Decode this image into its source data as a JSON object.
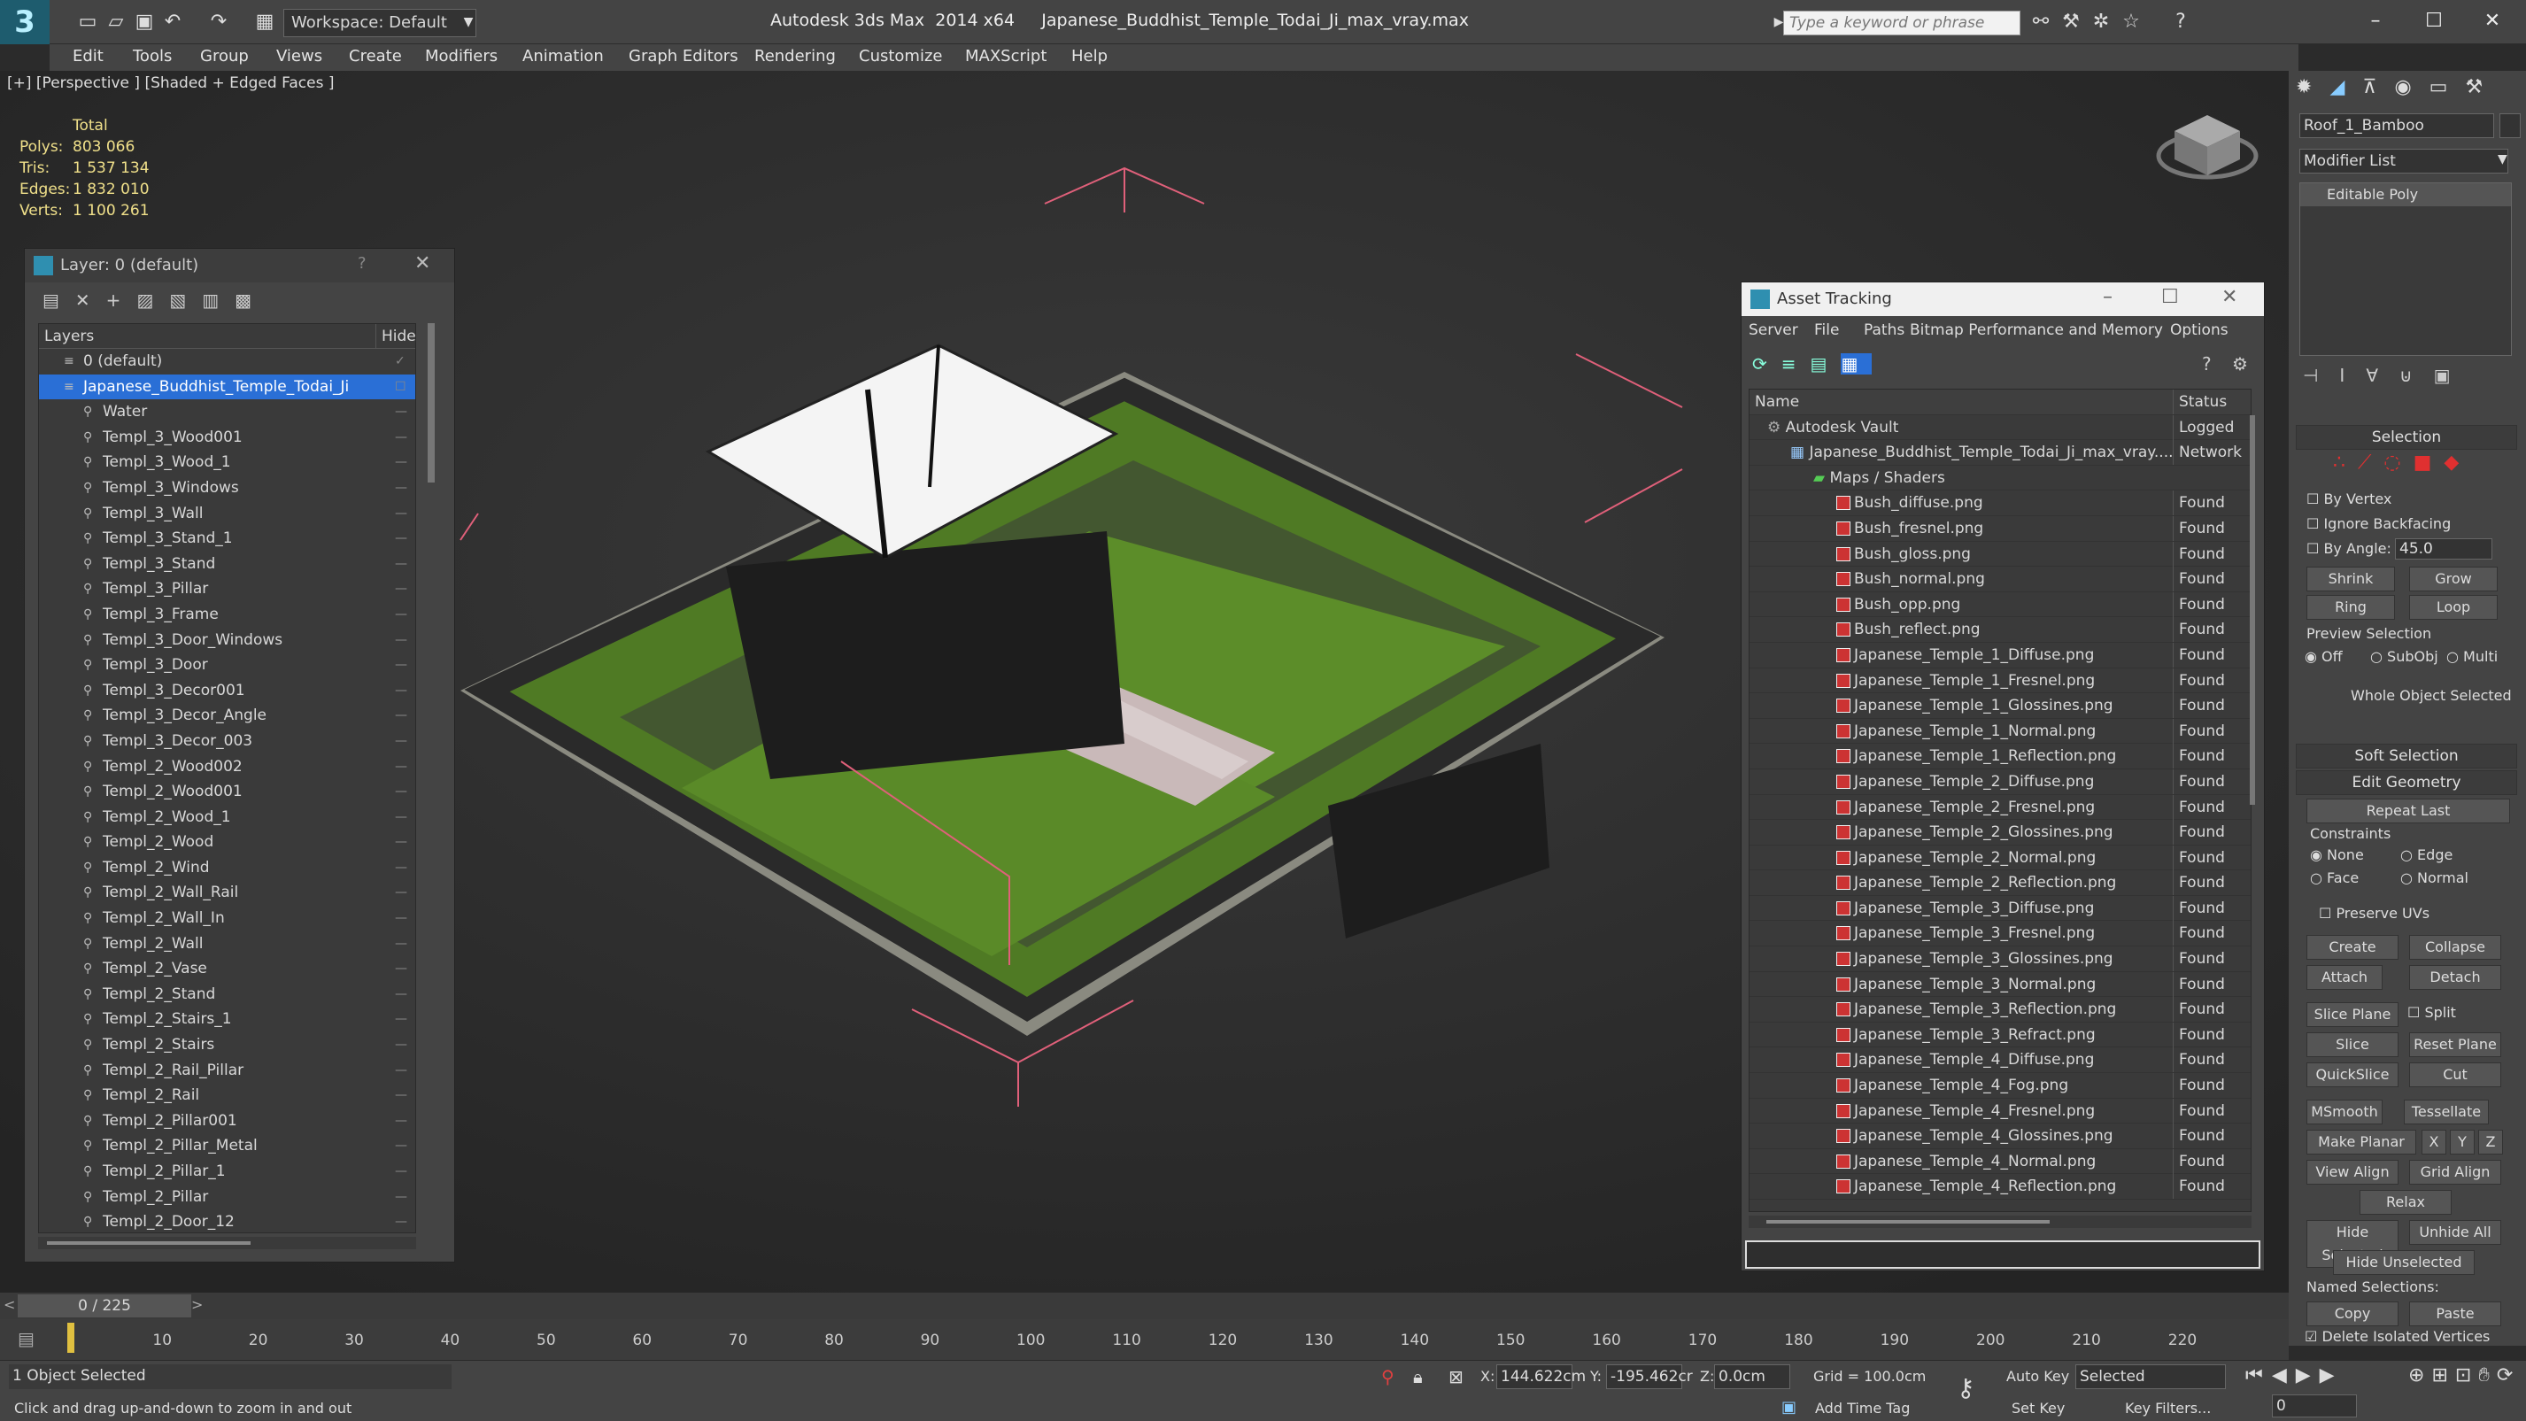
{
  "app": {
    "title": "Autodesk 3ds Max  2014 x64     Japanese_Buddhist_Temple_Todai_Ji_max_vray.max",
    "workspace": "Workspace: Default",
    "search_placeholder": "Type a keyword or phrase"
  },
  "menu": [
    "Edit",
    "Tools",
    "Group",
    "Views",
    "Create",
    "Modifiers",
    "Animation",
    "Graph Editors",
    "Rendering",
    "Customize",
    "MAXScript",
    "Help"
  ],
  "viewport": {
    "label": "[+] [Perspective ] [Shaded + Edged Faces ]",
    "stats": {
      "header": "Total",
      "rows": [
        {
          "k": "Polys:",
          "v": "803 066"
        },
        {
          "k": "Tris:",
          "v": "1 537 134"
        },
        {
          "k": "Edges:",
          "v": "1 832 010"
        },
        {
          "k": "Verts:",
          "v": "1 100 261"
        }
      ]
    }
  },
  "layer_panel": {
    "title": "Layer: 0 (default)",
    "help": "?",
    "col_layers": "Layers",
    "col_hide": "Hide",
    "items": [
      "0 (default)",
      "Japanese_Buddhist_Temple_Todai_Ji",
      "Water",
      "Templ_3_Wood001",
      "Templ_3_Wood_1",
      "Templ_3_Windows",
      "Templ_3_Wall",
      "Templ_3_Stand_1",
      "Templ_3_Stand",
      "Templ_3_Pillar",
      "Templ_3_Frame",
      "Templ_3_Door_Windows",
      "Templ_3_Door",
      "Templ_3_Decor001",
      "Templ_3_Decor_Angle",
      "Templ_3_Decor_003",
      "Templ_2_Wood002",
      "Templ_2_Wood001",
      "Templ_2_Wood_1",
      "Templ_2_Wood",
      "Templ_2_Wind",
      "Templ_2_Wall_Rail",
      "Templ_2_Wall_In",
      "Templ_2_Wall",
      "Templ_2_Vase",
      "Templ_2_Stand",
      "Templ_2_Stairs_1",
      "Templ_2_Stairs",
      "Templ_2_Rail_Pillar",
      "Templ_2_Rail",
      "Templ_2_Pillar001",
      "Templ_2_Pillar_Metal",
      "Templ_2_Pillar_1",
      "Templ_2_Pillar",
      "Templ_2_Door_12"
    ]
  },
  "asset_panel": {
    "title": "Asset Tracking",
    "menu": [
      "Server",
      "File",
      "Paths",
      "Bitmap Performance and Memory",
      "Options"
    ],
    "col_name": "Name",
    "col_status": "Status",
    "rows": [
      {
        "n": "Autodesk Vault",
        "s": "Logged",
        "lvl": 0
      },
      {
        "n": "Japanese_Buddhist_Temple_Todai_Ji_max_vray....",
        "s": "Network",
        "lvl": 1
      },
      {
        "n": "Maps / Shaders",
        "s": "",
        "lvl": 2
      },
      {
        "n": "Bush_diffuse.png",
        "s": "Found",
        "lvl": 3
      },
      {
        "n": "Bush_fresnel.png",
        "s": "Found",
        "lvl": 3
      },
      {
        "n": "Bush_gloss.png",
        "s": "Found",
        "lvl": 3
      },
      {
        "n": "Bush_normal.png",
        "s": "Found",
        "lvl": 3
      },
      {
        "n": "Bush_opp.png",
        "s": "Found",
        "lvl": 3
      },
      {
        "n": "Bush_reflect.png",
        "s": "Found",
        "lvl": 3
      },
      {
        "n": "Japanese_Temple_1_Diffuse.png",
        "s": "Found",
        "lvl": 3
      },
      {
        "n": "Japanese_Temple_1_Fresnel.png",
        "s": "Found",
        "lvl": 3
      },
      {
        "n": "Japanese_Temple_1_Glossines.png",
        "s": "Found",
        "lvl": 3
      },
      {
        "n": "Japanese_Temple_1_Normal.png",
        "s": "Found",
        "lvl": 3
      },
      {
        "n": "Japanese_Temple_1_Reflection.png",
        "s": "Found",
        "lvl": 3
      },
      {
        "n": "Japanese_Temple_2_Diffuse.png",
        "s": "Found",
        "lvl": 3
      },
      {
        "n": "Japanese_Temple_2_Fresnel.png",
        "s": "Found",
        "lvl": 3
      },
      {
        "n": "Japanese_Temple_2_Glossines.png",
        "s": "Found",
        "lvl": 3
      },
      {
        "n": "Japanese_Temple_2_Normal.png",
        "s": "Found",
        "lvl": 3
      },
      {
        "n": "Japanese_Temple_2_Reflection.png",
        "s": "Found",
        "lvl": 3
      },
      {
        "n": "Japanese_Temple_3_Diffuse.png",
        "s": "Found",
        "lvl": 3
      },
      {
        "n": "Japanese_Temple_3_Fresnel.png",
        "s": "Found",
        "lvl": 3
      },
      {
        "n": "Japanese_Temple_3_Glossines.png",
        "s": "Found",
        "lvl": 3
      },
      {
        "n": "Japanese_Temple_3_Normal.png",
        "s": "Found",
        "lvl": 3
      },
      {
        "n": "Japanese_Temple_3_Reflection.png",
        "s": "Found",
        "lvl": 3
      },
      {
        "n": "Japanese_Temple_3_Refract.png",
        "s": "Found",
        "lvl": 3
      },
      {
        "n": "Japanese_Temple_4_Diffuse.png",
        "s": "Found",
        "lvl": 3
      },
      {
        "n": "Japanese_Temple_4_Fog.png",
        "s": "Found",
        "lvl": 3
      },
      {
        "n": "Japanese_Temple_4_Fresnel.png",
        "s": "Found",
        "lvl": 3
      },
      {
        "n": "Japanese_Temple_4_Glossines.png",
        "s": "Found",
        "lvl": 3
      },
      {
        "n": "Japanese_Temple_4_Normal.png",
        "s": "Found",
        "lvl": 3
      },
      {
        "n": "Japanese_Temple_4_Reflection.png",
        "s": "Found",
        "lvl": 3
      }
    ]
  },
  "command_panel": {
    "object_name": "Roof_1_Bamboo",
    "modifier_list": "Modifier List",
    "stack_item": "Editable Poly",
    "selection": "Selection",
    "by_vertex": "By Vertex",
    "ignore_backfacing": "Ignore Backfacing",
    "by_angle": "By Angle:",
    "angle_value": "45.0",
    "shrink": "Shrink",
    "grow": "Grow",
    "ring": "Ring",
    "loop": "Loop",
    "preview_selection": "Preview Selection",
    "off": "Off",
    "subobj": "SubObj",
    "multi": "Multi",
    "whole_object": "Whole Object Selected",
    "soft_selection": "Soft Selection",
    "edit_geometry": "Edit Geometry",
    "repeat_last": "Repeat Last",
    "constraints": "Constraints",
    "none": "None",
    "edge": "Edge",
    "face": "Face",
    "normal": "Normal",
    "preserve_uvs": "Preserve UVs",
    "create": "Create",
    "collapse": "Collapse",
    "attach": "Attach",
    "detach": "Detach",
    "slice_plane": "Slice Plane",
    "split": "Split",
    "slice": "Slice",
    "reset_plane": "Reset Plane",
    "quickslice": "QuickSlice",
    "cut": "Cut",
    "msmooth": "MSmooth",
    "tessellate": "Tessellate",
    "make_planar": "Make Planar",
    "x": "X",
    "y": "Y",
    "z": "Z",
    "view_align": "View Align",
    "grid_align": "Grid Align",
    "relax": "Relax",
    "hide_selected": "Hide Selected",
    "unhide_all": "Unhide All",
    "hide_unselected": "Hide Unselected",
    "named_selections": "Named Selections:",
    "copy": "Copy",
    "paste": "Paste",
    "delete_isolated": "Delete Isolated Vertices"
  },
  "timeline": {
    "frame": "0 / 225",
    "ticks": [
      "10",
      "20",
      "30",
      "40",
      "50",
      "60",
      "70",
      "80",
      "90",
      "100",
      "110",
      "120",
      "130",
      "140",
      "150",
      "160",
      "170",
      "180",
      "190",
      "200",
      "210",
      "220"
    ]
  },
  "status": {
    "selected": "1 Object Selected",
    "hint": "Click and drag up-and-down to zoom in and out",
    "x_label": "X:",
    "x": "144.622cm",
    "y_label": "Y:",
    "y": "-195.462cr",
    "z_label": "Z:",
    "z": "0.0cm",
    "grid": "Grid = 100.0cm",
    "add_time_tag": "Add Time Tag",
    "auto_key": "Auto Key",
    "set_key": "Set Key",
    "key_mode": "Selected",
    "key_filters": "Key Filters...",
    "frame_field": "0"
  },
  "colors": {
    "accent": "#2a6fd6",
    "grass": "#4f7a24",
    "selection_box": "#e0607a"
  }
}
